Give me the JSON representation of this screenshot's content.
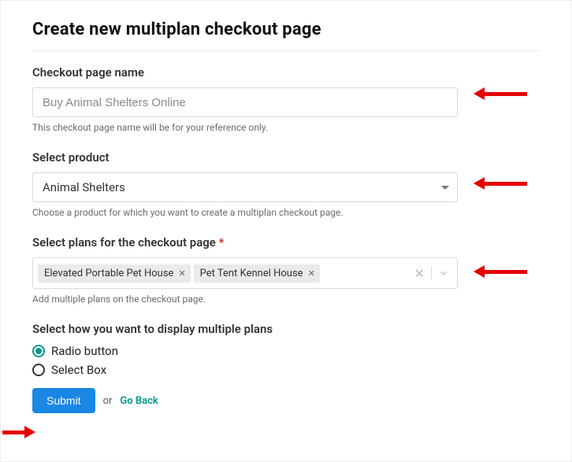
{
  "title": "Create new multiplan checkout page",
  "name_section": {
    "label": "Checkout page name",
    "value": "Buy Animal Shelters Online",
    "hint": "This checkout page name will be for your reference only."
  },
  "product_section": {
    "label": "Select product",
    "selected": "Animal Shelters",
    "hint": "Choose a product for which you want to create a multiplan checkout page."
  },
  "plans_section": {
    "label": "Select plans for the checkout page",
    "required_mark": "*",
    "chips": [
      "Elevated Portable Pet House",
      "Pet Tent Kennel House"
    ],
    "hint": "Add multiple plans on the checkout page."
  },
  "display_section": {
    "label": "Select how you want to display multiple plans",
    "options": {
      "radio": "Radio button",
      "select": "Select Box"
    },
    "selected": "radio"
  },
  "actions": {
    "submit": "Submit",
    "or": "or",
    "back": "Go Back"
  }
}
